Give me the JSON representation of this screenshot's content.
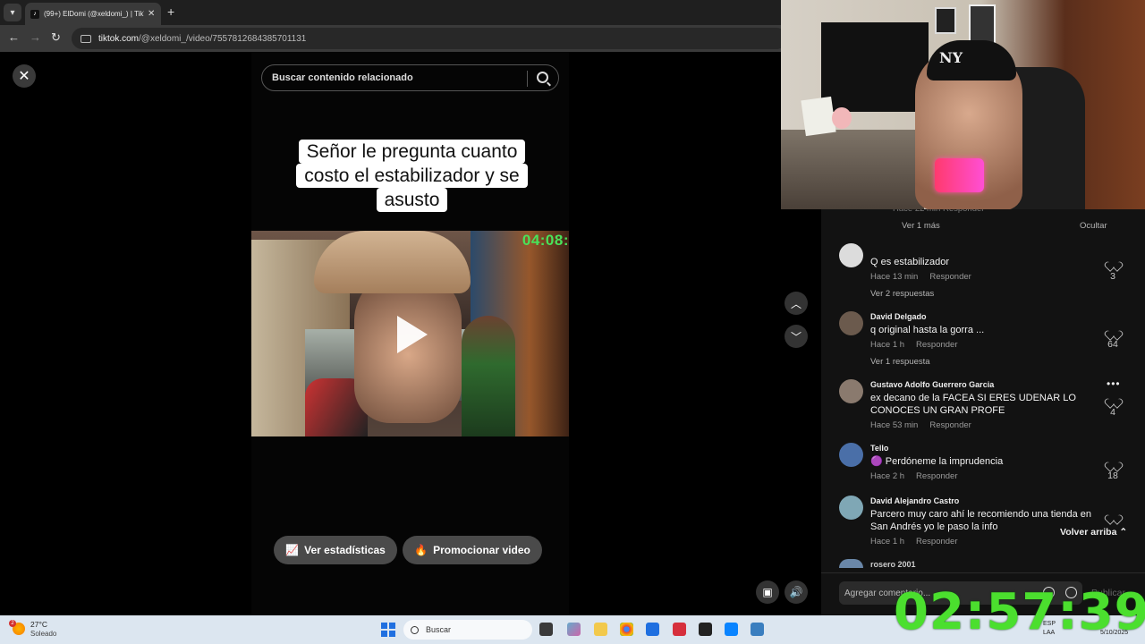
{
  "browser": {
    "tab_count_badge": "(99+)",
    "tab_title": "(99+) ElDomi (@xeldomi_) | TikTok",
    "url_domain": "tiktok.com",
    "url_path": "/@xeldomi_/video/7557812684385701131"
  },
  "viewer": {
    "search_placeholder": "Buscar contenido relacionado",
    "caption_lines": [
      "Señor le pregunta cuanto",
      "costo el estabilizador y se",
      "asusto"
    ],
    "video_timer": "04:08:",
    "stats_button": "Ver estadísticas",
    "promote_button": "Promocionar video"
  },
  "comments": {
    "top_fragment": "Hace 22 min     Responder",
    "see_more": "Ver 1 más",
    "hide": "Ocultar",
    "items": [
      {
        "user": "",
        "text": "Q es estabilizador",
        "time": "Hace 13 min",
        "reply": "Responder",
        "likes": "3",
        "replies": "Ver 2 respuestas",
        "avatar_color": "#dcdcdc"
      },
      {
        "user": "David Delgado",
        "text": "q original hasta la gorra ...",
        "time": "Hace 1 h",
        "reply": "Responder",
        "likes": "64",
        "replies": "Ver 1 respuesta",
        "avatar_color": "#6b5a4d"
      },
      {
        "user": "Gustavo Adolfo Guerrero Garcia",
        "text": "ex decano de la FACEA SI ERES UDENAR LO CONOCES UN GRAN PROFE",
        "time": "Hace 53 min",
        "reply": "Responder",
        "likes": "4",
        "replies": "",
        "avatar_color": "#8a7a6e"
      },
      {
        "user": "Tello",
        "text": "🟣 Perdóneme la imprudencia",
        "time": "Hace 2 h",
        "reply": "Responder",
        "likes": "18",
        "replies": "",
        "avatar_color": "#4a6fa8"
      },
      {
        "user": "David Alejandro Castro",
        "text": "Parcero muy caro ahí le recomiendo una tienda en San Andrés yo le paso la info",
        "time": "Hace 1 h",
        "reply": "Responder",
        "likes": "",
        "replies": "",
        "avatar_color": "#7fa7b5"
      }
    ],
    "cutoff_user": "rosero 2001",
    "back_to_top": "Volver arriba",
    "input_placeholder": "Agregar comentario...",
    "publish": "Publicar"
  },
  "taskbar": {
    "temperature": "27°C",
    "condition": "Soleado",
    "search_label": "Buscar",
    "tray_lang": "ESP",
    "tray_lang2": "LAA",
    "tray_date": "5/10/2025"
  },
  "stream_timer": "02:57:39",
  "colors": {
    "timer_green": "#4bdf2e",
    "video_timer_green": "#49e25a"
  }
}
